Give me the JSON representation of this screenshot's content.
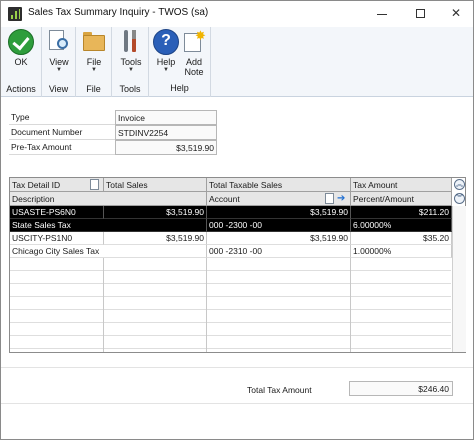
{
  "window": {
    "title": "Sales Tax Summary Inquiry  -  TWOS (sa)",
    "min_glyph": "—",
    "close_glyph": "✕"
  },
  "ribbon": {
    "ok_label": "OK",
    "actions_group": "Actions",
    "view_label": "View",
    "view_group": "View",
    "file_label": "File",
    "file_group": "File",
    "tools_label": "Tools",
    "tools_group": "Tools",
    "help_label": "Help",
    "add_note_line1": "Add",
    "add_note_line2": "Note",
    "help_group": "Help",
    "dropdown_glyph": "▼",
    "help_glyph": "?",
    "note_star_glyph": "✸"
  },
  "header": {
    "type_label": "Type",
    "type_value": "Invoice",
    "docnum_label": "Document Number",
    "docnum_value": "STDINV2254",
    "pretax_label": "Pre-Tax Amount",
    "pretax_value": "$3,519.90"
  },
  "grid": {
    "columns_row1": [
      "Tax Detail ID",
      "Total Sales",
      "Total Taxable Sales",
      "Tax Amount"
    ],
    "columns_row2": [
      "Description",
      "Account",
      "Percent/Amount"
    ],
    "scroll_up_glyph": "︽",
    "scroll_down_glyph": "︾",
    "arrow_glyph": "➔",
    "rows": [
      {
        "tax_detail_id": "USASTE-PS6N0",
        "total_sales": "$3,519.90",
        "total_taxable_sales": "$3,519.90",
        "tax_amount": "$211.20",
        "description": "State Sales Tax",
        "account": "000 -2300 -00",
        "percent": "6.00000%",
        "selected": true
      },
      {
        "tax_detail_id": "USCITY-PS1N0",
        "total_sales": "$3,519.90",
        "total_taxable_sales": "$3,519.90",
        "tax_amount": "$35.20",
        "description": "Chicago City Sales Tax",
        "account": "000 -2310 -00",
        "percent": "1.00000%",
        "selected": false
      }
    ]
  },
  "footer": {
    "total_tax_label": "Total Tax Amount",
    "total_tax_value": "$246.40"
  }
}
